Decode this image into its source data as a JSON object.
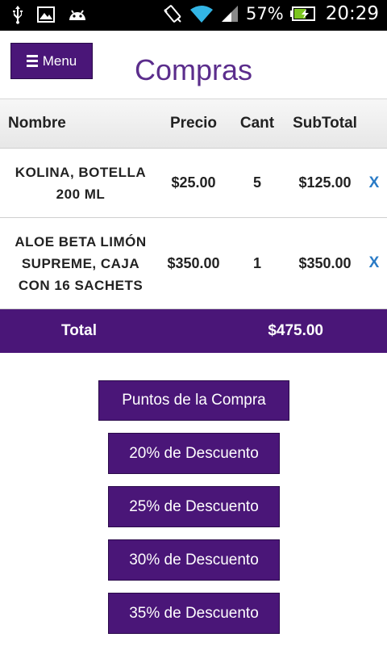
{
  "status_bar": {
    "battery_percent": "57%",
    "time": "20:29",
    "icons": [
      "usb-icon",
      "image-icon",
      "android-icon",
      "vibrate-icon",
      "wifi-icon",
      "signal-icon",
      "battery-charging-icon"
    ]
  },
  "header": {
    "menu_label": "Menu",
    "title": "Compras"
  },
  "table": {
    "columns": [
      "Nombre",
      "Precio",
      "Cant",
      "SubTotal"
    ],
    "rows": [
      {
        "name_line1": "KOLINA, BOTELLA",
        "name_line2": "200 ML",
        "name_line3": "",
        "price": "$25.00",
        "qty": "5",
        "subtotal": "$125.00",
        "remove": "X"
      },
      {
        "name_line1": "ALOE BETA LIMÓN",
        "name_line2": "SUPREME, CAJA",
        "name_line3": "CON 16 SACHETS",
        "price": "$350.00",
        "qty": "1",
        "subtotal": "$350.00",
        "remove": "X"
      }
    ],
    "total_label": "Total",
    "total_value": "$475.00"
  },
  "actions": {
    "points": "Puntos de la Compra",
    "discount_20": "20% de Descuento",
    "discount_25": "25% de Descuento",
    "discount_30": "30% de Descuento",
    "discount_35": "35% de Descuento"
  },
  "colors": {
    "primary": "#4a1678",
    "title": "#5b2d8c",
    "remove": "#2a7bc6"
  }
}
